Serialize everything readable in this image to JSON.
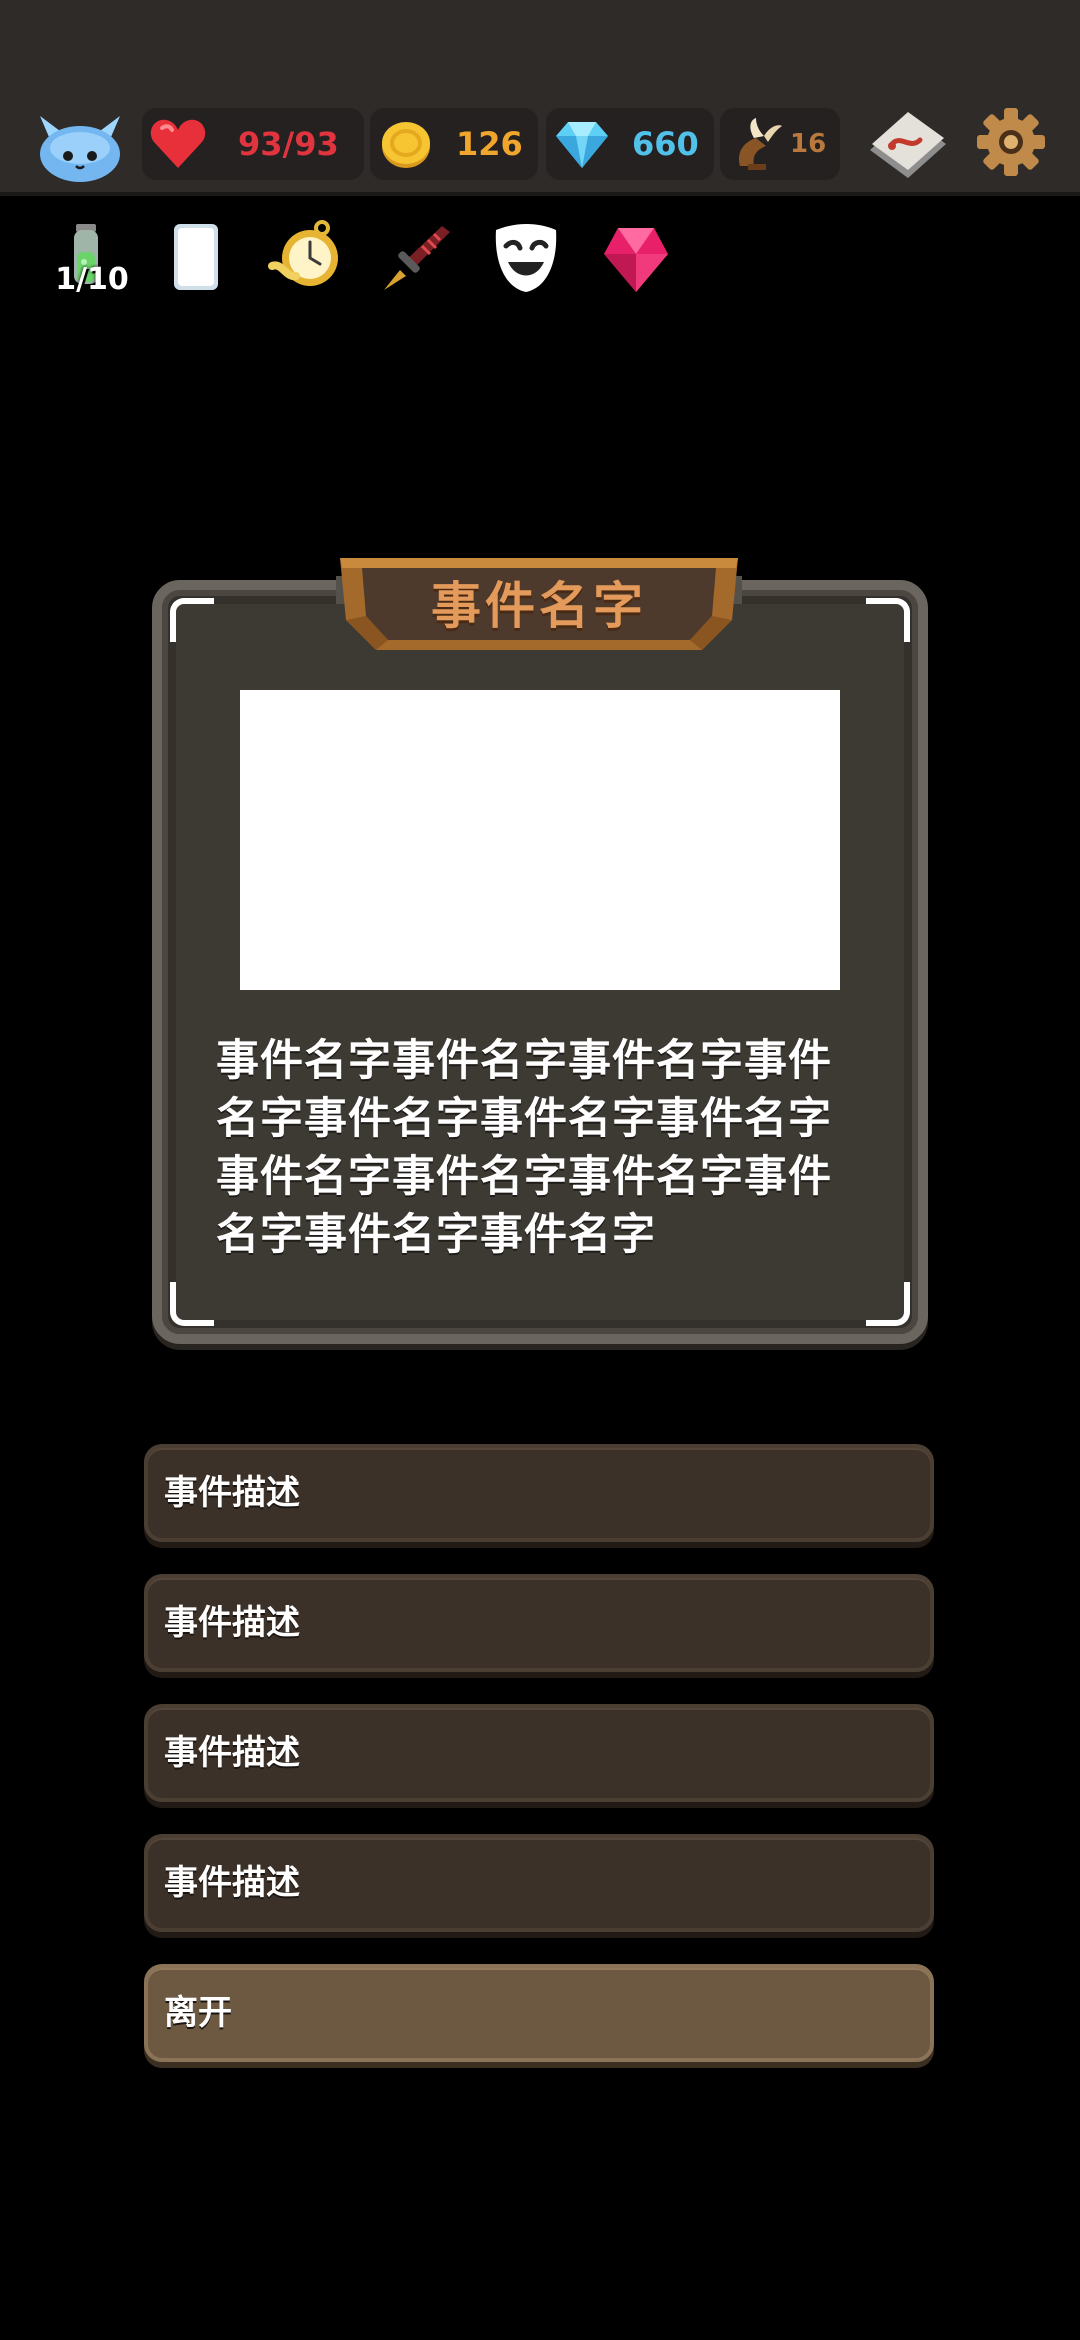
{
  "topbar": {
    "hp": "93/93",
    "gold": "126",
    "gems": "660",
    "horns": "16",
    "icons": {
      "avatar": "blue-slime-avatar-icon",
      "hp": "heart-icon",
      "gold": "gold-coin-icon",
      "gem": "diamond-icon",
      "horn": "winged-horn-icon",
      "map": "map-scroll-icon",
      "settings": "gear-icon"
    }
  },
  "relics": {
    "potion_count": "1/10",
    "items": [
      "potion-icon",
      "blank-card-icon",
      "pocket-watch-icon",
      "dagger-icon",
      "smiling-mask-icon",
      "pink-crystal-icon"
    ]
  },
  "event": {
    "title": "事件名字",
    "description": "事件名字事件名字事件名字事件名字事件名字事件名字事件名字事件名字事件名字事件名字事件名字事件名字事件名字"
  },
  "options": [
    {
      "label": "事件描述"
    },
    {
      "label": "事件描述"
    },
    {
      "label": "事件描述"
    },
    {
      "label": "事件描述"
    },
    {
      "label": "离开"
    }
  ],
  "colors": {
    "hp": "#e0343f",
    "gold": "#f0a52c",
    "gem": "#52c1ea",
    "horn": "#b9793c",
    "banner_text": "#e39a5a"
  }
}
